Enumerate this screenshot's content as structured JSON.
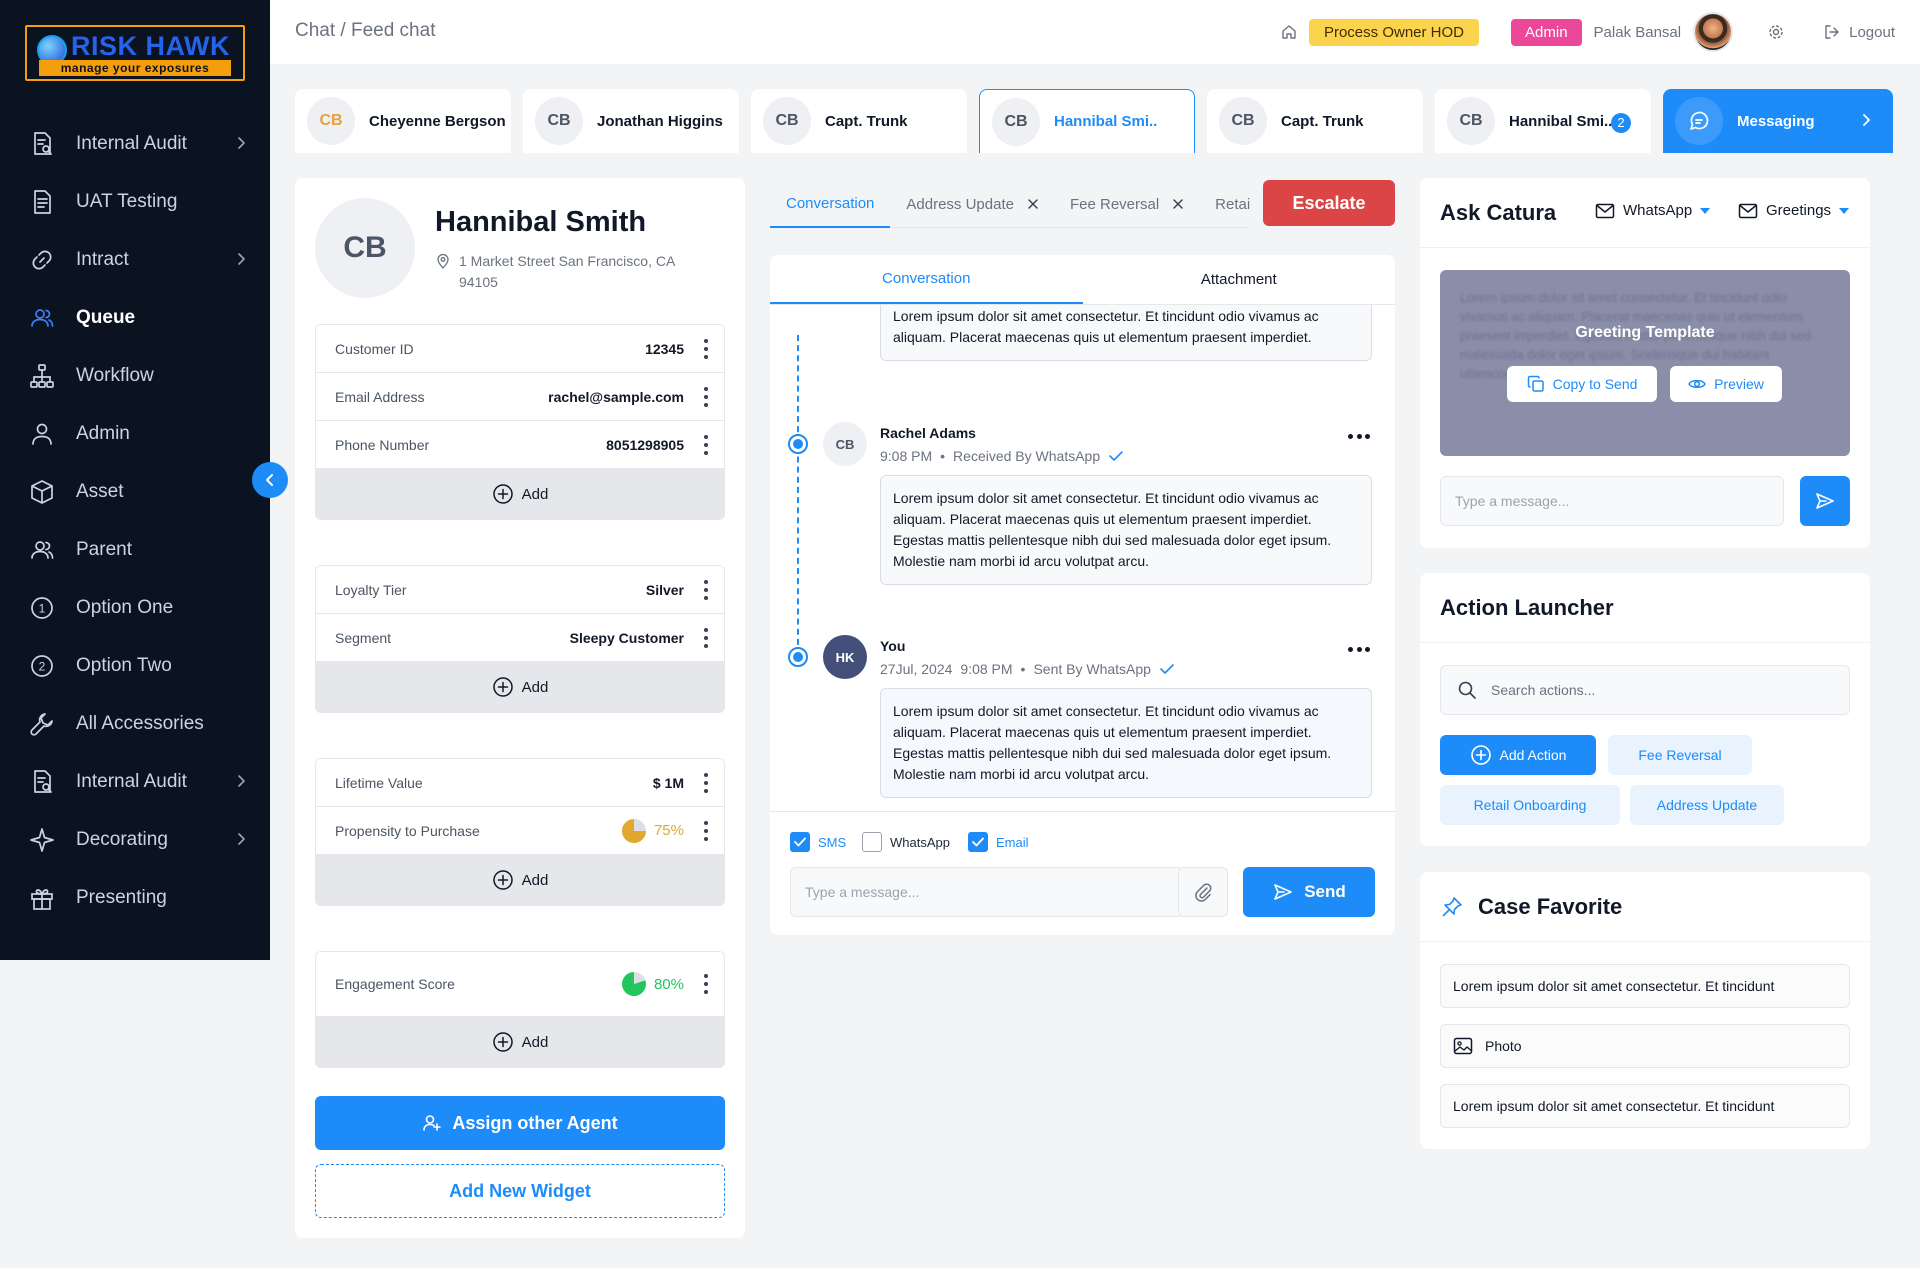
{
  "app": {
    "logo_name": "RISK HAWK",
    "logo_tagline": "manage your exposures"
  },
  "sidebar": {
    "items": [
      {
        "label": "Internal Audit",
        "icon": "audit-doc-icon",
        "chevron": true
      },
      {
        "label": "UAT Testing",
        "icon": "document-list-icon",
        "chevron": false
      },
      {
        "label": "Intract",
        "icon": "link-icon",
        "chevron": true
      },
      {
        "label": "Queue",
        "icon": "users-icon",
        "chevron": false,
        "active": true
      },
      {
        "label": "Workflow",
        "icon": "hierarchy-icon",
        "chevron": false
      },
      {
        "label": "Admin",
        "icon": "user-icon",
        "chevron": false
      },
      {
        "label": "Asset",
        "icon": "box-icon",
        "chevron": false
      },
      {
        "label": "Parent",
        "icon": "users-icon",
        "chevron": false
      },
      {
        "label": "Option One",
        "icon": "number-one-icon",
        "chevron": false
      },
      {
        "label": "Option Two",
        "icon": "number-two-icon",
        "chevron": false
      },
      {
        "label": "All Accessories",
        "icon": "wrench-icon",
        "chevron": false
      },
      {
        "label": "Internal Audit",
        "icon": "audit-doc-icon",
        "chevron": true
      },
      {
        "label": "Decorating",
        "icon": "sparkle-icon",
        "chevron": true
      },
      {
        "label": "Presenting",
        "icon": "gift-icon",
        "chevron": false
      }
    ]
  },
  "header": {
    "breadcrumb": "Chat / Feed chat",
    "role_badge": "Process Owner HOD",
    "admin_badge": "Admin",
    "user_name": "Palak Bansal",
    "logout": "Logout"
  },
  "chat_tabs": [
    {
      "initials": "CB",
      "name": "Cheyenne Bergson",
      "initials_color": "#e6a23c"
    },
    {
      "initials": "CB",
      "name": "Jonathan Higgins"
    },
    {
      "initials": "CB",
      "name": "Capt. Trunk"
    },
    {
      "initials": "CB",
      "name": "Hannibal Smi..",
      "active": true
    },
    {
      "initials": "CB",
      "name": "Capt. Trunk"
    },
    {
      "initials": "CB",
      "name": "Hannibal Smi..",
      "count": "2"
    }
  ],
  "messaging_tab": {
    "label": "Messaging"
  },
  "profile": {
    "initials": "CB",
    "name": "Hannibal Smith",
    "address": "1 Market Street San Francisco, CA 94105",
    "add_label": "Add",
    "groups": [
      [
        {
          "key": "Customer ID",
          "value": "12345"
        },
        {
          "key": "Email Address",
          "value": "rachel@sample.com"
        },
        {
          "key": "Phone Number",
          "value": "8051298905"
        }
      ],
      [
        {
          "key": "Loyalty Tier",
          "value": "Silver"
        },
        {
          "key": "Segment",
          "value": "Sleepy Customer"
        }
      ],
      [
        {
          "key": "Lifetime Value",
          "value": "$ 1M"
        },
        {
          "key": "Propensity to Purchase",
          "value": "75%",
          "percent": 75,
          "color": "#e0a82e"
        }
      ],
      [
        {
          "key": "Engagement Score",
          "value": "80%",
          "percent": 80,
          "color": "#22c55e"
        }
      ]
    ],
    "assign_button": "Assign other Agent",
    "add_widget_button": "Add New Widget"
  },
  "conversation_tabs": [
    {
      "label": "Conversation",
      "active": true,
      "closable": false
    },
    {
      "label": "Address Update",
      "closable": true
    },
    {
      "label": "Fee Reversal",
      "closable": true
    },
    {
      "label": "Retail Onboarding",
      "closable": false
    }
  ],
  "escalate_button": "Escalate",
  "conversation": {
    "tabs": [
      "Conversation",
      "Attachment"
    ],
    "truncated_message": "Lorem ipsum dolor sit amet consectetur. Et tincidunt odio vivamus ac aliquam. Placerat maecenas quis ut elementum praesent imperdiet.",
    "messages": [
      {
        "initials": "CB",
        "author": "Rachel Adams",
        "date": "",
        "time": "9:08 PM",
        "status": "Received By WhatsApp",
        "text": "Lorem ipsum dolor sit amet consectetur. Et tincidunt odio vivamus ac aliquam. Placerat maecenas quis ut elementum praesent imperdiet. Egestas mattis pellentesque nibh dui sed malesuada dolor eget ipsum. Molestie nam morbi id arcu volutpat arcu."
      },
      {
        "initials": "HK",
        "author": "You",
        "date": "27Jul, 2024",
        "time": "9:08 PM",
        "status": "Sent By WhatsApp",
        "text": "Lorem ipsum dolor sit amet consectetur. Et tincidunt odio vivamus ac aliquam. Placerat maecenas quis ut elementum praesent imperdiet. Egestas mattis pellentesque nibh dui sed malesuada dolor eget ipsum. Molestie nam morbi id arcu volutpat arcu."
      }
    ],
    "channels": [
      {
        "label": "SMS",
        "checked": true
      },
      {
        "label": "WhatsApp",
        "checked": false
      },
      {
        "label": "Email",
        "checked": true
      }
    ],
    "input_placeholder": "Type a message...",
    "send_button": "Send"
  },
  "ask_catura": {
    "title": "Ask Catura",
    "channel_dropdown": "WhatsApp",
    "template_dropdown": "Greetings",
    "template_title": "Greeting Template",
    "template_preview_text": "Lorem ipsum dolor sit amet consectetur. Et tincidunt odio vivamus ac aliquam. Placerat maecenas quis ut elementum praesent imperdiet. Egestas mattis pellentesque nibh dui sed malesuada dolor eget ipsum. Scelerisque dui habitant ullamcorper dictum. Feugiat",
    "copy_button": "Copy to Send",
    "preview_button": "Preview",
    "input_placeholder": "Type a message..."
  },
  "action_launcher": {
    "title": "Action Launcher",
    "search_placeholder": "Search actions...",
    "add_action": "Add Action",
    "chips": [
      "Fee Reversal",
      "Retail Onboarding",
      "Address Update"
    ]
  },
  "case_favorite": {
    "title": "Case Favorite",
    "items": [
      {
        "label": "Lorem ipsum dolor sit amet consectetur. Et tincidunt",
        "icon": ""
      },
      {
        "label": "Photo",
        "icon": "image-icon"
      },
      {
        "label": "Lorem ipsum dolor sit amet consectetur. Et tincidunt",
        "icon": ""
      }
    ]
  },
  "colors": {
    "accent": "#1d8cf8",
    "sidebar_bg": "#0b1220",
    "escalate": "#dc4545",
    "role_badge": "#fcd34d",
    "admin_badge": "#ec4899"
  }
}
